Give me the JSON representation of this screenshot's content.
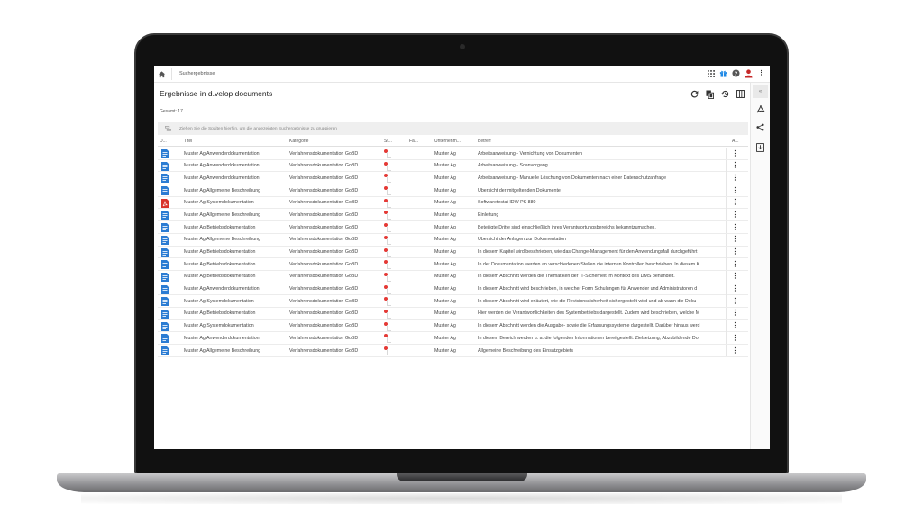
{
  "breadcrumb": "Suchergebnisse",
  "title": "Ergebnisse in d.velop documents",
  "total_text": "Gesamt: 17",
  "group_hint": "Ziehen Sie die Spalten hierhin, um die angezeigten Suchergebnisse zu gruppieren",
  "columns": {
    "doc": "D...",
    "titel": "Titel",
    "kategorie": "Kategorie",
    "status": "St...",
    "fa": "Fa...",
    "unternehmen": "Unternehm...",
    "betreff": "Betreff",
    "actions": "A..."
  },
  "colors": {
    "doc_blue": "#2b7cd3",
    "pdf_red": "#d9342b",
    "status_red": "#e53935",
    "accent_red": "#c62828"
  },
  "rows": [
    {
      "icon": "word-doc-icon",
      "titel": "Muster Ag Anwenderdokumentation",
      "kategorie": "Verfahrensdokumentation GoBD",
      "unternehmen": "Muster Ag",
      "betreff": "Arbeitsanweisung - Vernichtung von Dokumenten"
    },
    {
      "icon": "word-doc-icon",
      "titel": "Muster Ag Anwenderdokumentation",
      "kategorie": "Verfahrensdokumentation GoBD",
      "unternehmen": "Muster Ag",
      "betreff": "Arbeitsanweisung - Scanvorgang"
    },
    {
      "icon": "word-doc-icon",
      "titel": "Muster Ag Anwenderdokumentation",
      "kategorie": "Verfahrensdokumentation GoBD",
      "unternehmen": "Muster Ag",
      "betreff": "Arbeitsanweisung - Manuelle Löschung von Dokumenten nach einer Datenschutzanfrage"
    },
    {
      "icon": "word-doc-icon",
      "titel": "Muster Ag Allgemeine Beschreibung",
      "kategorie": "Verfahrensdokumentation GoBD",
      "unternehmen": "Muster Ag",
      "betreff": "Übersicht der mitgeltenden Dokumente"
    },
    {
      "icon": "pdf-doc-icon",
      "titel": "Muster Ag Systemdokumentation",
      "kategorie": "Verfahrensdokumentation GoBD",
      "unternehmen": "Muster Ag",
      "betreff": "Softwaretestat IDW PS 880"
    },
    {
      "icon": "word-doc-icon",
      "titel": "Muster Ag Allgemeine Beschreibung",
      "kategorie": "Verfahrensdokumentation GoBD",
      "unternehmen": "Muster Ag",
      "betreff": "Einleitung"
    },
    {
      "icon": "word-doc-icon",
      "titel": "Muster Ag Betriebsdokumentation",
      "kategorie": "Verfahrensdokumentation GoBD",
      "unternehmen": "Muster Ag",
      "betreff": "Beteiligte Dritte sind einschließlich ihres Verantwortungsbereichs bekanntzumachen."
    },
    {
      "icon": "word-doc-icon",
      "titel": "Muster Ag Allgemeine Beschreibung",
      "kategorie": "Verfahrensdokumentation GoBD",
      "unternehmen": "Muster Ag",
      "betreff": "Übersicht der Anlagen zur Dokumentation"
    },
    {
      "icon": "word-doc-icon",
      "titel": "Muster Ag Betriebsdokumentation",
      "kategorie": "Verfahrensdokumentation GoBD",
      "unternehmen": "Muster Ag",
      "betreff": "In diesem Kapitel wird beschrieben, wie das Change-Management für den Anwendungsfall durchgeführt"
    },
    {
      "icon": "word-doc-icon",
      "titel": "Muster Ag Betriebsdokumentation",
      "kategorie": "Verfahrensdokumentation GoBD",
      "unternehmen": "Muster Ag",
      "betreff": "In der Dokumentation werden an verschiedenen Stellen die internen Kontrollen beschrieben. In diesem K"
    },
    {
      "icon": "word-doc-icon",
      "titel": "Muster Ag Betriebsdokumentation",
      "kategorie": "Verfahrensdokumentation GoBD",
      "unternehmen": "Muster Ag",
      "betreff": "In diesem Abschnitt werden die Thematiken der IT-Sicherheit im Kontext des DMS behandelt."
    },
    {
      "icon": "word-doc-icon",
      "titel": "Muster Ag Anwenderdokumentation",
      "kategorie": "Verfahrensdokumentation GoBD",
      "unternehmen": "Muster Ag",
      "betreff": "In diesem Abschnitt wird beschrieben, in welcher Form Schulungen für Anwender und Administratoren d"
    },
    {
      "icon": "word-doc-icon",
      "titel": "Muster Ag Systemdokumentation",
      "kategorie": "Verfahrensdokumentation GoBD",
      "unternehmen": "Muster Ag",
      "betreff": "In diesem Abschnitt wird erläutert, wie die Revisionssicherheit sichergestellt wird und ab wann die Doku"
    },
    {
      "icon": "word-doc-icon",
      "titel": "Muster Ag Betriebsdokumentation",
      "kategorie": "Verfahrensdokumentation GoBD",
      "unternehmen": "Muster Ag",
      "betreff": "Hier werden die Verantwortlichkeiten des Systembetriebs dargestellt. Zudem wird beschrieben, welche M"
    },
    {
      "icon": "word-doc-icon",
      "titel": "Muster Ag Systemdokumentation",
      "kategorie": "Verfahrensdokumentation GoBD",
      "unternehmen": "Muster Ag",
      "betreff": "In diesem Abschnitt werden die Ausgabe- sowie die Erfassungssysteme dargestellt. Darüber hinaus werd"
    },
    {
      "icon": "word-doc-icon",
      "titel": "Muster Ag Anwenderdokumentation",
      "kategorie": "Verfahrensdokumentation GoBD",
      "unternehmen": "Muster Ag",
      "betreff": "In diesem Bereich werden u. a. die folgenden Informationen bereitgestellt:  Zielsetzung, Abzubildende Do"
    },
    {
      "icon": "word-doc-icon",
      "titel": "Muster Ag Allgemeine Beschreibung",
      "kategorie": "Verfahrensdokumentation GoBD",
      "unternehmen": "Muster Ag",
      "betreff": "Allgemeine Beschreibung des Einsatzgebiets"
    }
  ]
}
